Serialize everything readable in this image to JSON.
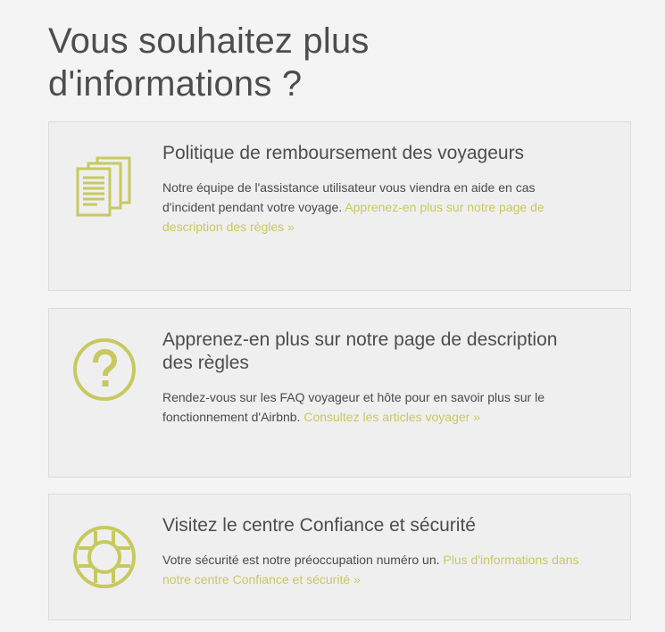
{
  "page": {
    "title": "Vous souhaitez plus d'informations ?"
  },
  "colors": {
    "accent": "#c7c960",
    "card_bg": "#efefef",
    "page_bg": "#f4f4f4",
    "text": "#4a4a4a"
  },
  "cards": [
    {
      "icon": "documents-icon",
      "title": "Politique de remboursement des voyageurs",
      "text": "Notre équipe de l'assistance utilisateur vous viendra en aide en cas d'incident pendant votre voyage.",
      "link": "Apprenez-en plus sur notre page de description des règles »"
    },
    {
      "icon": "question-mark-icon",
      "title": "Apprenez-en plus sur notre page de description des règles",
      "text": "Rendez-vous sur les FAQ voyageur et hôte pour en savoir plus sur le fonctionnement d'Airbnb.",
      "link": "Consultez les articles voyager »"
    },
    {
      "icon": "lifebuoy-icon",
      "title": "Visitez le centre Confiance et sécurité",
      "text": "Votre sécurité est notre préoccupation numéro un.",
      "link": "Plus d'informations dans notre centre Confiance et sécurité »"
    }
  ]
}
